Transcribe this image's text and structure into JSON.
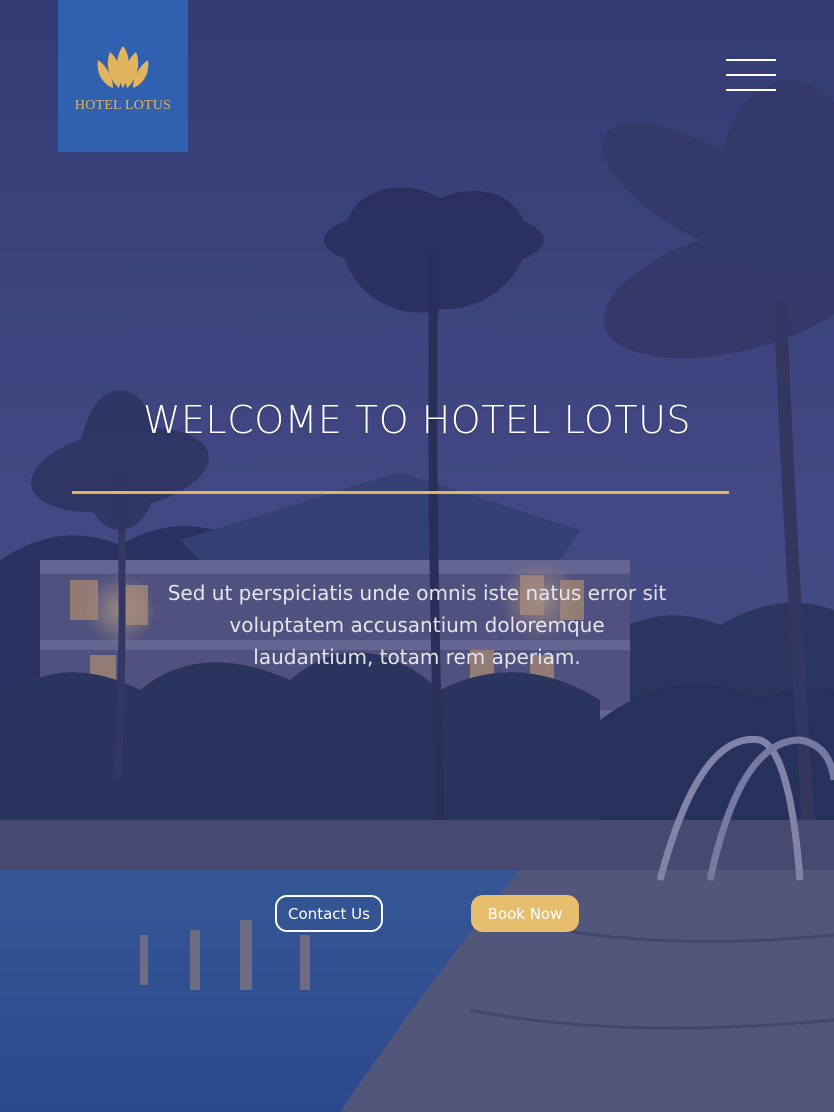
{
  "brand": {
    "name": "HOTEL LOTUS",
    "accent_color": "#e3b45e",
    "logo_box_color": "#3060b0"
  },
  "header": {
    "menu_icon": "hamburger-menu-icon"
  },
  "hero": {
    "title": "WELCOME TO HOTEL LOTUS",
    "text": "Sed ut perspiciatis unde omnis iste natus error sit voluptatem accusantium doloremque laudantium, totam rem aperiam.",
    "contact_label": "Contact Us",
    "book_label": "Book Now",
    "book_button_color": "#e6be6e",
    "overlay_color": "#28306e"
  }
}
